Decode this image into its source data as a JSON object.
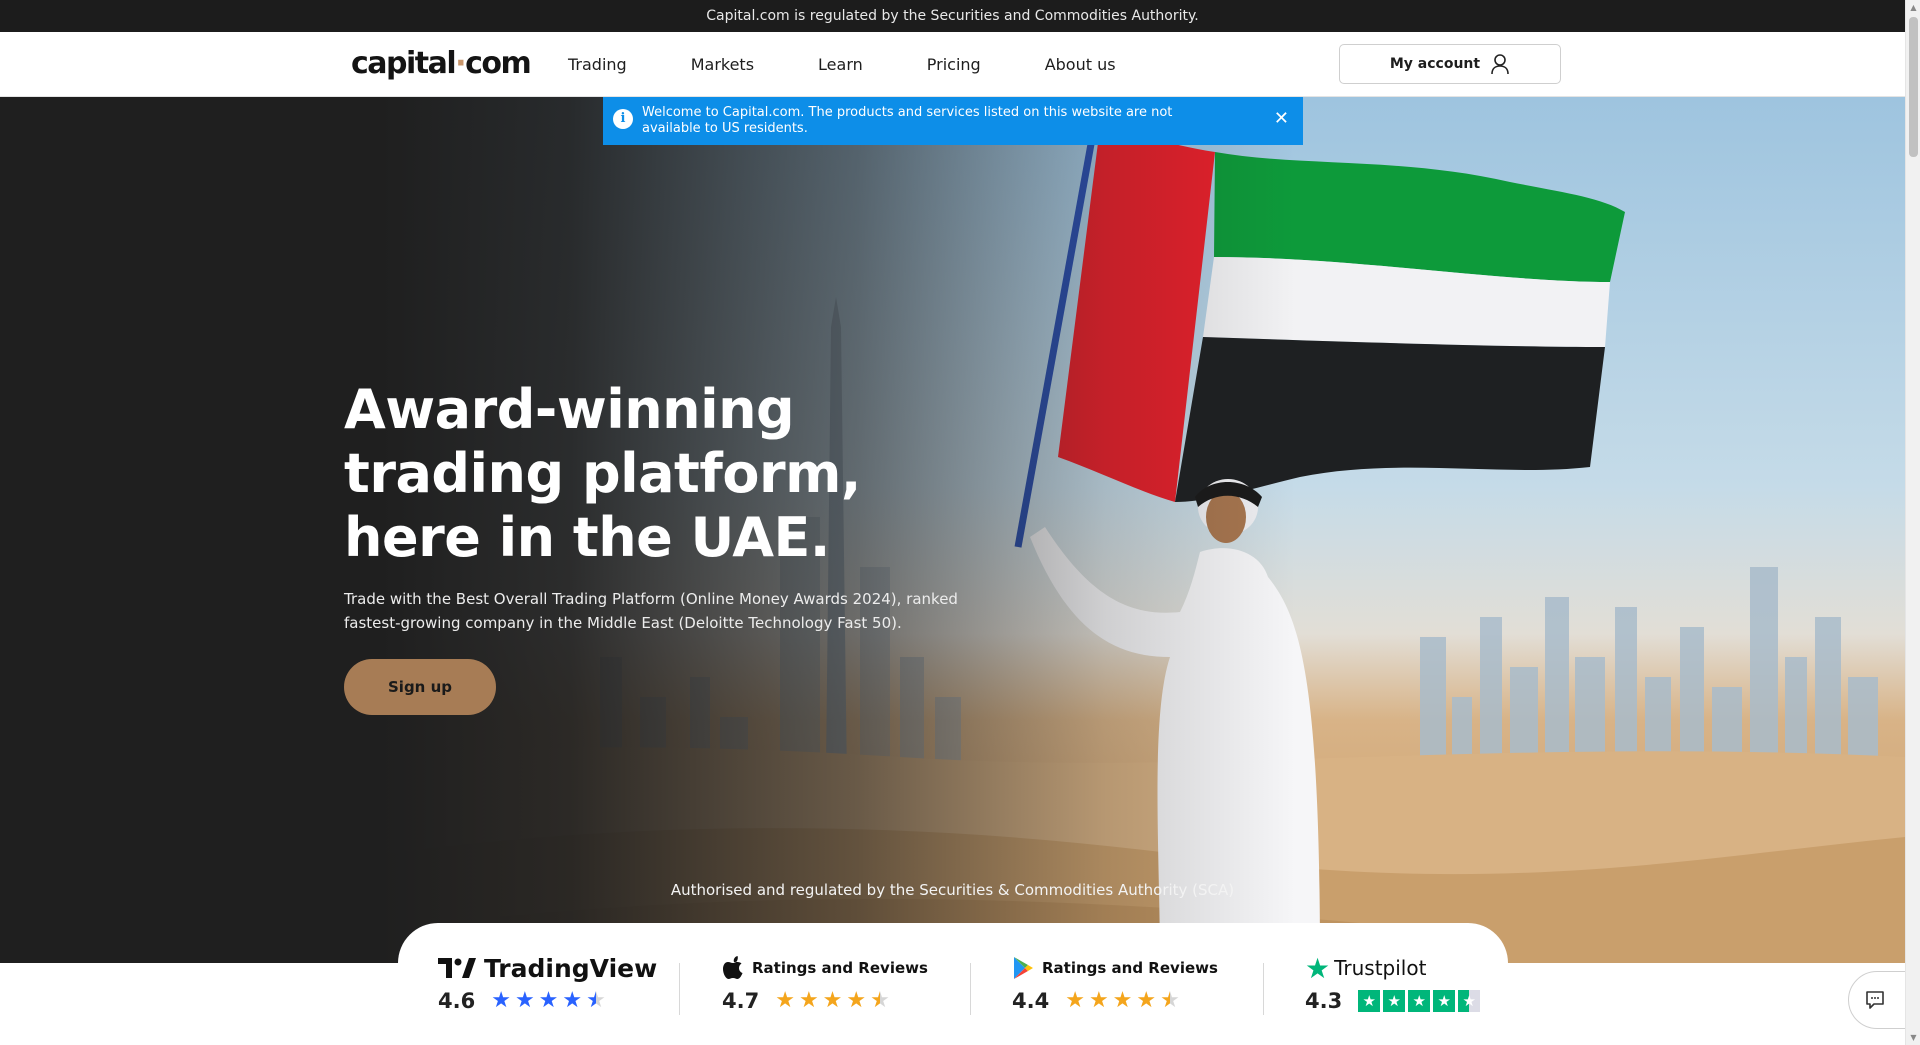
{
  "topbar": {
    "text": "Capital.com is regulated by the Securities and Commodities Authority."
  },
  "header": {
    "logo_left": "capital",
    "logo_dot": "·",
    "logo_right": "com",
    "nav": [
      "Trading",
      "Markets",
      "Learn",
      "Pricing",
      "About us"
    ],
    "account_label": "My account"
  },
  "notice": {
    "text": "Welcome to Capital.com. The products and services listed on this website are not available to US residents.",
    "close": "✕",
    "info": "i"
  },
  "hero": {
    "headline": "Award-winning trading platform, here in the UAE.",
    "subtext": "Trade with the Best Overall Trading Platform (Online Money Awards 2024), ranked fastest-growing company in the Middle East (Deloitte Technology Fast 50).",
    "cta": "Sign up",
    "regulated": "Authorised and regulated by the Securities & Commodities Authority (SCA)"
  },
  "ratings": [
    {
      "source": "TradingView",
      "score": "4.6",
      "stars": 4.5,
      "star_color": "#2962ff"
    },
    {
      "source": "Ratings and Reviews",
      "platform_icon": "apple-icon",
      "score": "4.7",
      "stars": 4.5,
      "star_color": "#f4a51c"
    },
    {
      "source": "Ratings and Reviews",
      "platform_icon": "google-play-icon",
      "score": "4.4",
      "stars": 4.5,
      "star_color": "#f4a51c"
    },
    {
      "source": "Trustpilot",
      "score": "4.3",
      "stars": 4.5,
      "star_color": "#00b67a"
    }
  ],
  "colors": {
    "notice_bg": "#0d8ee8",
    "cta_bg": "#a77c55",
    "topbar_bg": "#1c1c1c",
    "trustpilot_green": "#00b67a"
  }
}
